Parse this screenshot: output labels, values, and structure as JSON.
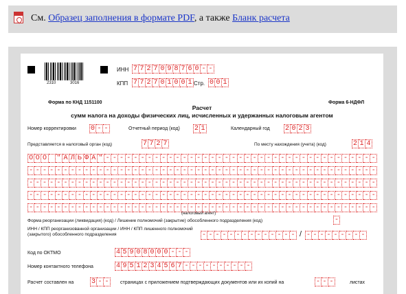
{
  "links": {
    "prefix": "См. ",
    "pdf_link": "Образец заполнения в формате PDF",
    "middle": ", а также ",
    "calc_link": "Бланк расчета"
  },
  "header": {
    "barcode_left": "2310",
    "barcode_right": "3016",
    "inn_label": "ИНН",
    "inn_cells": [
      "7",
      "7",
      "2",
      "7",
      "0",
      "9",
      "8",
      "7",
      "6",
      "0",
      "-",
      "-"
    ],
    "kpp_label": "КПП",
    "kpp_cells": [
      "7",
      "7",
      "2",
      "7",
      "0",
      "1",
      "0",
      "0",
      "1"
    ],
    "page_label": "Стр.",
    "page_cells": [
      "0",
      "0",
      "1"
    ],
    "knd_form": "Форма по КНД 1151100",
    "form_code": "Форма 6-НДФЛ"
  },
  "title": {
    "line1": "Расчет",
    "line2": "сумм налога на доходы физических лиц, исчисленных и удержанных налоговым агентом"
  },
  "fields": {
    "correction_label": "Номер корректировки",
    "correction_cells": [
      "0",
      "-",
      "-"
    ],
    "period_label": "Отчетный период (код)",
    "period_cells": [
      "2",
      "1"
    ],
    "year_label": "Календарный год",
    "year_cells": [
      "2",
      "0",
      "2",
      "3"
    ],
    "authority_label": "Представляется в налоговый орган (код)",
    "authority_cells": [
      "7",
      "7",
      "2",
      "7"
    ],
    "location_label": "По месту нахождения (учета) (код)",
    "location_cells": [
      "2",
      "1",
      "4"
    ],
    "agent_name_line1": "ООО \"АЛЬФА\"",
    "agent_caption": "(налоговый агент)",
    "reorg_label": "Форма реорганизации (ликвидация) (код) / Лишение полномочий (закрытие) обособленного подразделения (код)",
    "reorg_cells": [
      "-"
    ],
    "reorg_inn_label": "ИНН / КПП реорганизованной организации / ИНН / КПП лишенного полномочий (закрытого) обособленного подразделения",
    "oktmo_label": "Код по ОКТМО",
    "oktmo_cells": [
      "4",
      "5",
      "9",
      "0",
      "8",
      "0",
      "0",
      "0",
      "-",
      "-",
      "-"
    ],
    "phone_label": "Номер контактного телефона",
    "phone_cells": [
      "4",
      "9",
      "5",
      "1",
      "2",
      "3",
      "4",
      "5",
      "6",
      "7",
      "-",
      "-",
      "-",
      "-",
      "-",
      "-",
      "-",
      "-",
      "-",
      "-"
    ],
    "pages_label": "Расчет составлен на",
    "pages_cells": [
      "3",
      "-",
      "-"
    ],
    "pages_text": "страницах с приложением подтверждающих документов или их копий на",
    "attach_cells": [
      "-",
      "-",
      "-"
    ],
    "sheets_label": "листах"
  }
}
